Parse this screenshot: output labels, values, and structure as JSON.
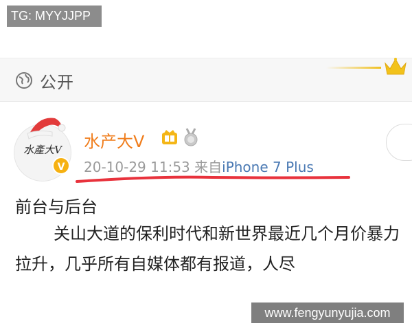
{
  "corner_badge": {
    "text": "TG: MYYJJPP"
  },
  "visibility": {
    "icon": "globe-icon",
    "label": "公开"
  },
  "decoration": {
    "crown_icon": "crown-icon",
    "gold_line_color": "#f0c020"
  },
  "post": {
    "author": {
      "avatar_text": "水產大V",
      "name": "水产大V",
      "name_color": "#f07d1c",
      "badges": [
        "vip-icon",
        "medal-icon"
      ],
      "verified_icon": "verified-v-icon"
    },
    "timestamp": "20-10-29 11:53",
    "source_prefix": "来自",
    "source_device": "iPhone 7 Plus",
    "underline_color": "#e8323c",
    "title": "前台与后台",
    "body": "关山大道的保利时代和新世界最近几个月价暴力拉升，几乎所有自媒体都有报道，人尽"
  },
  "footer_watermark": {
    "text": "www.fengyunyujia.com"
  }
}
